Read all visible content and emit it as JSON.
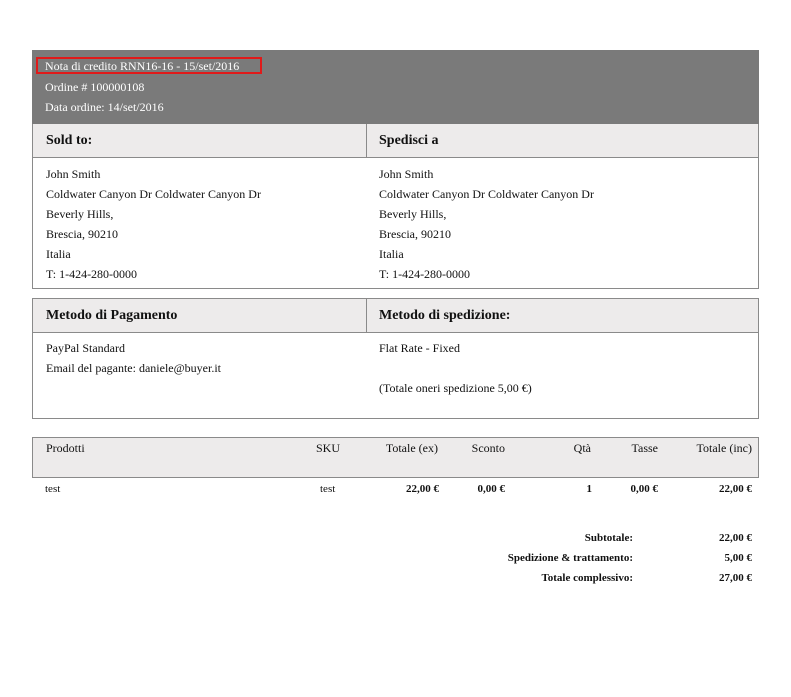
{
  "header": {
    "credit_note": "Nota di credito RNN16-16 - 15/set/2016",
    "order_number": "Ordine # 100000108",
    "order_date": "Data ordine: 14/set/2016"
  },
  "address": {
    "sold_to_title": "Sold to:",
    "ship_to_title": "Spedisci a",
    "sold_to": [
      "John Smith",
      "Coldwater Canyon Dr Coldwater Canyon Dr",
      "Beverly Hills,",
      "Brescia, 90210",
      "Italia",
      "T: 1-424-280-0000"
    ],
    "ship_to": [
      "John Smith",
      "Coldwater Canyon Dr Coldwater Canyon Dr",
      "Beverly Hills,",
      "Brescia, 90210",
      "Italia",
      "T: 1-424-280-0000"
    ]
  },
  "methods": {
    "payment_title": "Metodo di Pagamento",
    "shipping_title": "Metodo di spedizione:",
    "payment_method": "PayPal Standard",
    "payer_email": "Email del pagante: daniele@buyer.it",
    "shipping_method": "Flat Rate - Fixed",
    "shipping_total": "(Totale oneri spedizione 5,00 €)"
  },
  "products": {
    "columns": [
      "Prodotti",
      "SKU",
      "Totale (ex)",
      "Sconto",
      "Qtà",
      "Tasse",
      "Totale (inc)"
    ],
    "rows": [
      {
        "name": "test",
        "sku": "test",
        "total_ex": "22,00 €",
        "discount": "0,00 €",
        "qty": "1",
        "tax": "0,00 €",
        "total_inc": "22,00 €"
      }
    ]
  },
  "totals": [
    {
      "label": "Subtotale:",
      "value": "22,00 €"
    },
    {
      "label": "Spedizione & trattamento:",
      "value": "5,00 €"
    },
    {
      "label": "Totale complessivo:",
      "value": "27,00 €"
    }
  ]
}
